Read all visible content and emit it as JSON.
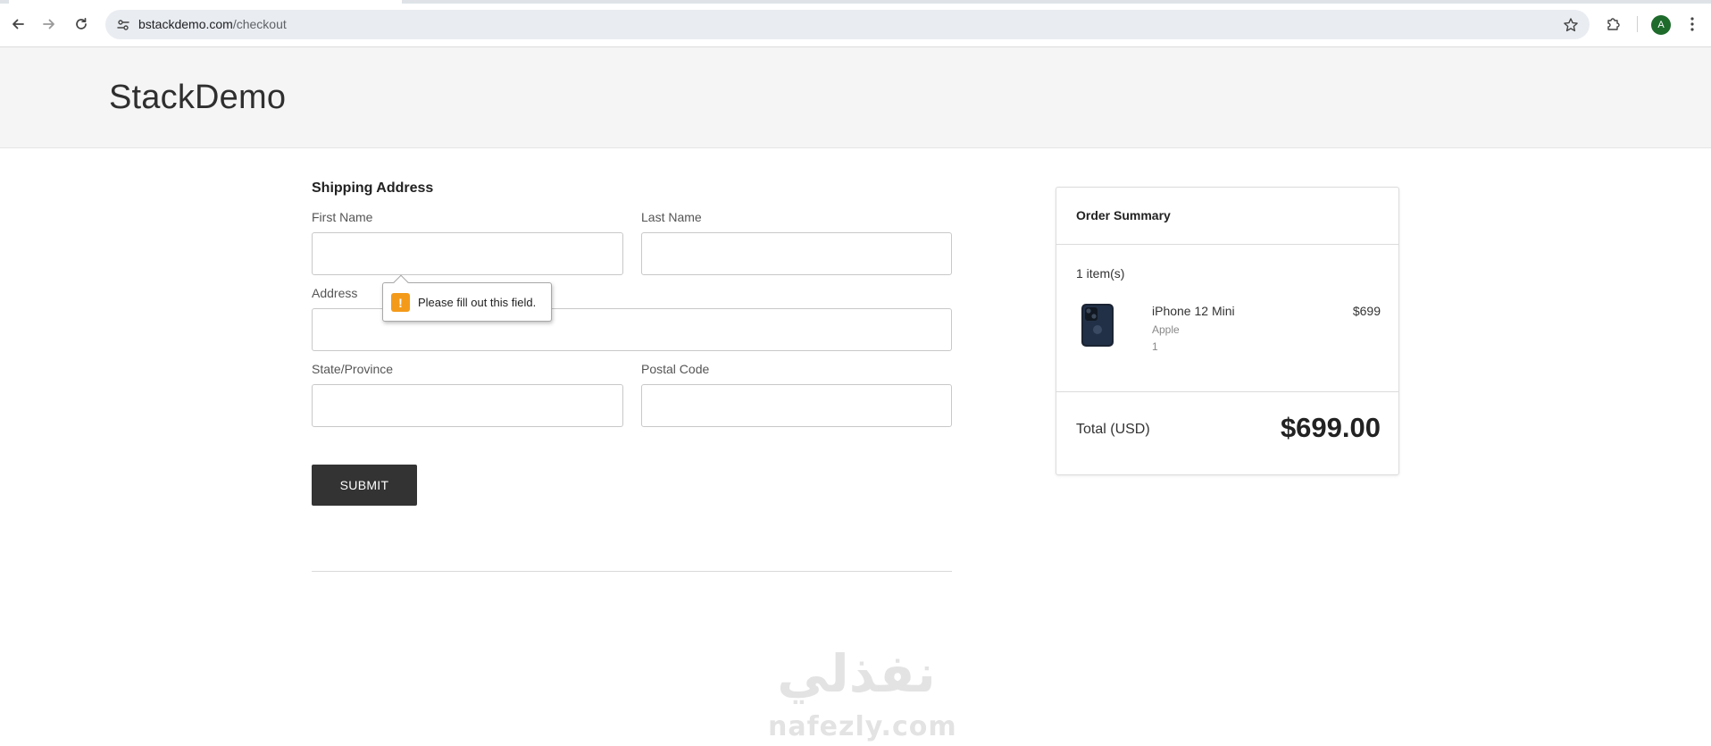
{
  "browser": {
    "url_host": "bstackdemo.com",
    "url_path": "/checkout",
    "profile_initial": "A",
    "icons": {
      "back": "arrow-left-icon",
      "forward": "arrow-right-icon",
      "reload": "reload-icon",
      "site_info": "tune-icon",
      "bookmark": "star-icon",
      "extensions": "puzzle-icon",
      "menu": "kebab-menu-icon"
    },
    "colors": {
      "avatar": "#1e6b2c"
    }
  },
  "site": {
    "logo": "StackDemo"
  },
  "shipping": {
    "heading": "Shipping Address",
    "first_name": {
      "label": "First Name",
      "value": ""
    },
    "last_name": {
      "label": "Last Name",
      "value": ""
    },
    "address": {
      "label": "Address",
      "value": ""
    },
    "state": {
      "label": "State/Province",
      "value": ""
    },
    "postal": {
      "label": "Postal Code",
      "value": ""
    },
    "submit_label": "SUBMIT"
  },
  "validation": {
    "message": "Please fill out this field.",
    "icon": "warning-icon",
    "color": "#f49a1a"
  },
  "order_summary": {
    "title": "Order Summary",
    "item_count": "1 item(s)",
    "items": [
      {
        "name": "iPhone 12 Mini",
        "brand": "Apple",
        "quantity": "1",
        "price": "$699",
        "image_icon": "iphone-icon"
      }
    ],
    "total_label": "Total (USD)",
    "total_value": "$699.00"
  },
  "watermark": {
    "arabic": "نفذلي",
    "latin": "nafezly.com"
  }
}
